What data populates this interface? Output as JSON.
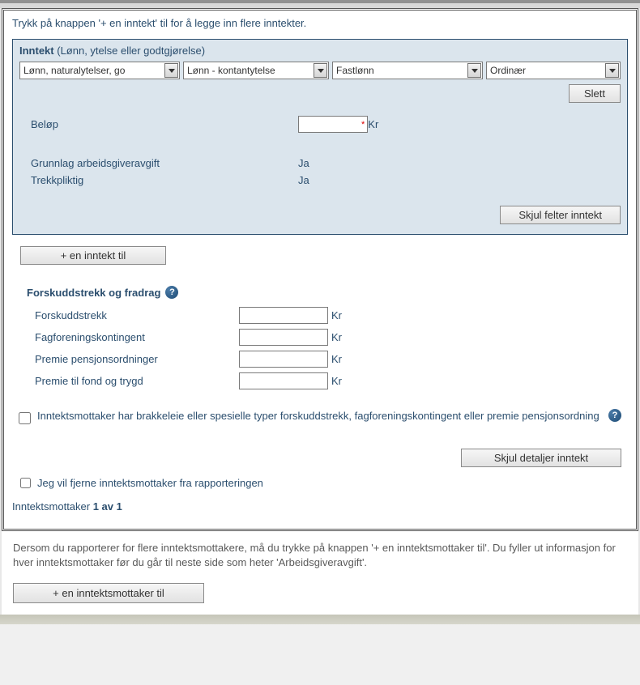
{
  "top_instruction": "Trykk på knappen '+ en inntekt' til for å legge inn flere inntekter.",
  "inntekt": {
    "title": "Inntekt",
    "subtitle": "(Lønn, ytelse eller godtgjørelse)",
    "select1": "Lønn, naturalytelser, go",
    "select2": "Lønn - kontantytelse",
    "select3": "Fastlønn",
    "select4": "Ordinær",
    "slett": "Slett",
    "belop_label": "Beløp",
    "belop_value": "",
    "belop_unit": "Kr",
    "grunnlag_label": "Grunnlag arbeidsgiveravgift",
    "grunnlag_value": "Ja",
    "trekk_label": "Trekkpliktig",
    "trekk_value": "Ja",
    "skjul": "Skjul felter inntekt"
  },
  "add_inntekt": "+ en inntekt til",
  "forskudd": {
    "title": "Forskuddstrekk og fradrag",
    "rows": {
      "r1": {
        "label": "Forskuddstrekk",
        "value": "",
        "unit": "Kr"
      },
      "r2": {
        "label": "Fagforeningskontingent",
        "value": "",
        "unit": "Kr"
      },
      "r3": {
        "label": "Premie pensjonsordninger",
        "value": "",
        "unit": "Kr"
      },
      "r4": {
        "label": "Premie til fond og trygd",
        "value": "",
        "unit": "Kr"
      }
    }
  },
  "brakkel_checkbox": "Inntektsmottaker har brakkeleie eller spesielle typer forskuddstrekk, fagforeningskontingent eller premie pensjonsordning",
  "skjul_detaljer": "Skjul detaljer inntekt",
  "fjern_checkbox": "Jeg vil fjerne inntektsmottaker fra rapporteringen",
  "counter_prefix": "Inntektsmottaker ",
  "counter_value": "1 av 1",
  "bottom_instruction": "Dersom du rapporterer for flere inntektsmottakere, må du trykke på knappen '+ en inntektsmottaker til'. Du fyller ut informasjon for hver inntektsmottaker før du går til neste side som heter 'Arbeidsgiveravgift'.",
  "add_mottaker": "+ en inntektsmottaker til"
}
